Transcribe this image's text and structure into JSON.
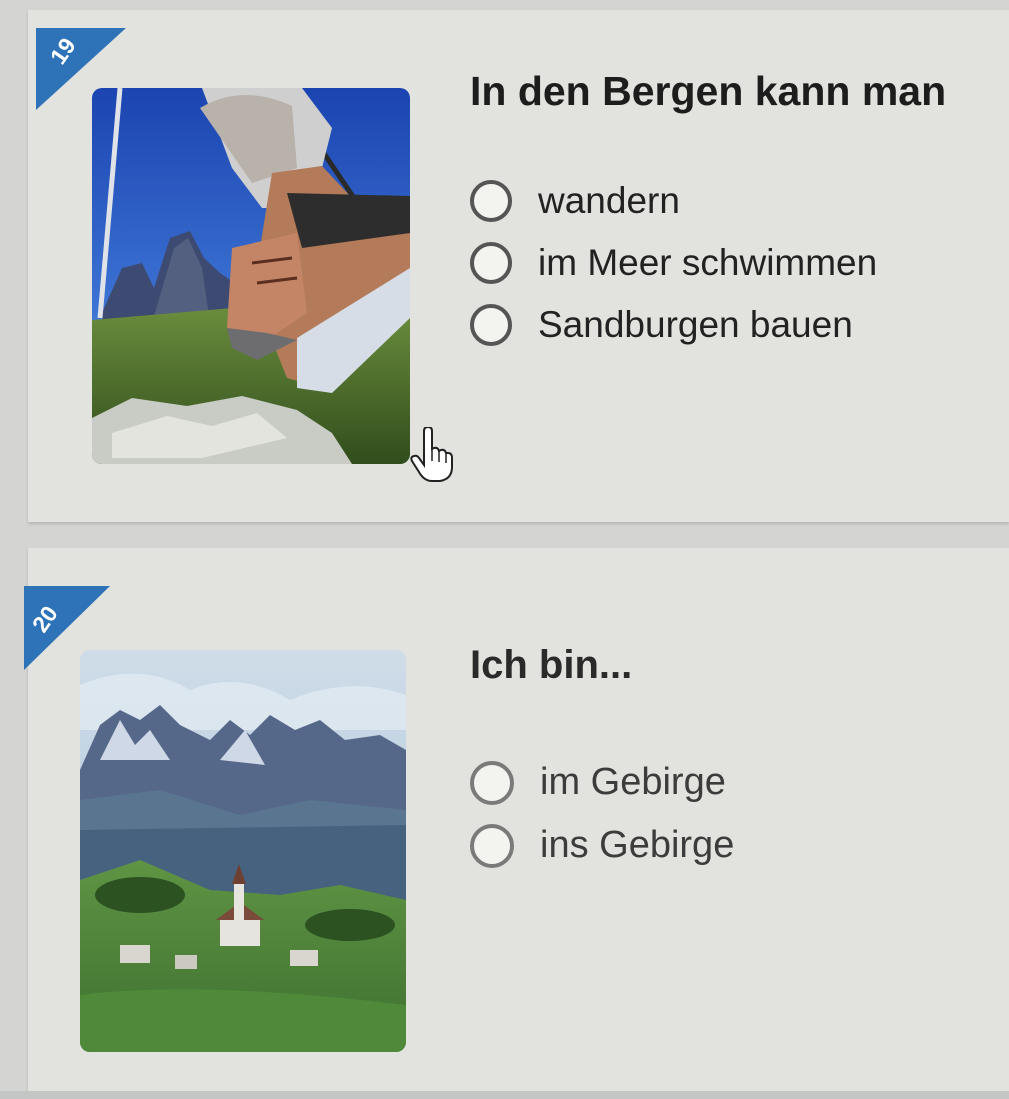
{
  "questions": [
    {
      "number": "19",
      "prompt": "In den Bergen kann man",
      "options": [
        "wandern",
        "im Meer schwimmen",
        "Sandburgen bauen"
      ],
      "image_icon": "hiking-boots-photo",
      "badge_color": "#2e73b8"
    },
    {
      "number": "20",
      "prompt": "Ich bin...",
      "options": [
        "im Gebirge",
        "ins Gebirge"
      ],
      "image_icon": "mountain-village-photo",
      "badge_color": "#2e73b8"
    }
  ],
  "cursor_icon": "hand-pointer-icon"
}
